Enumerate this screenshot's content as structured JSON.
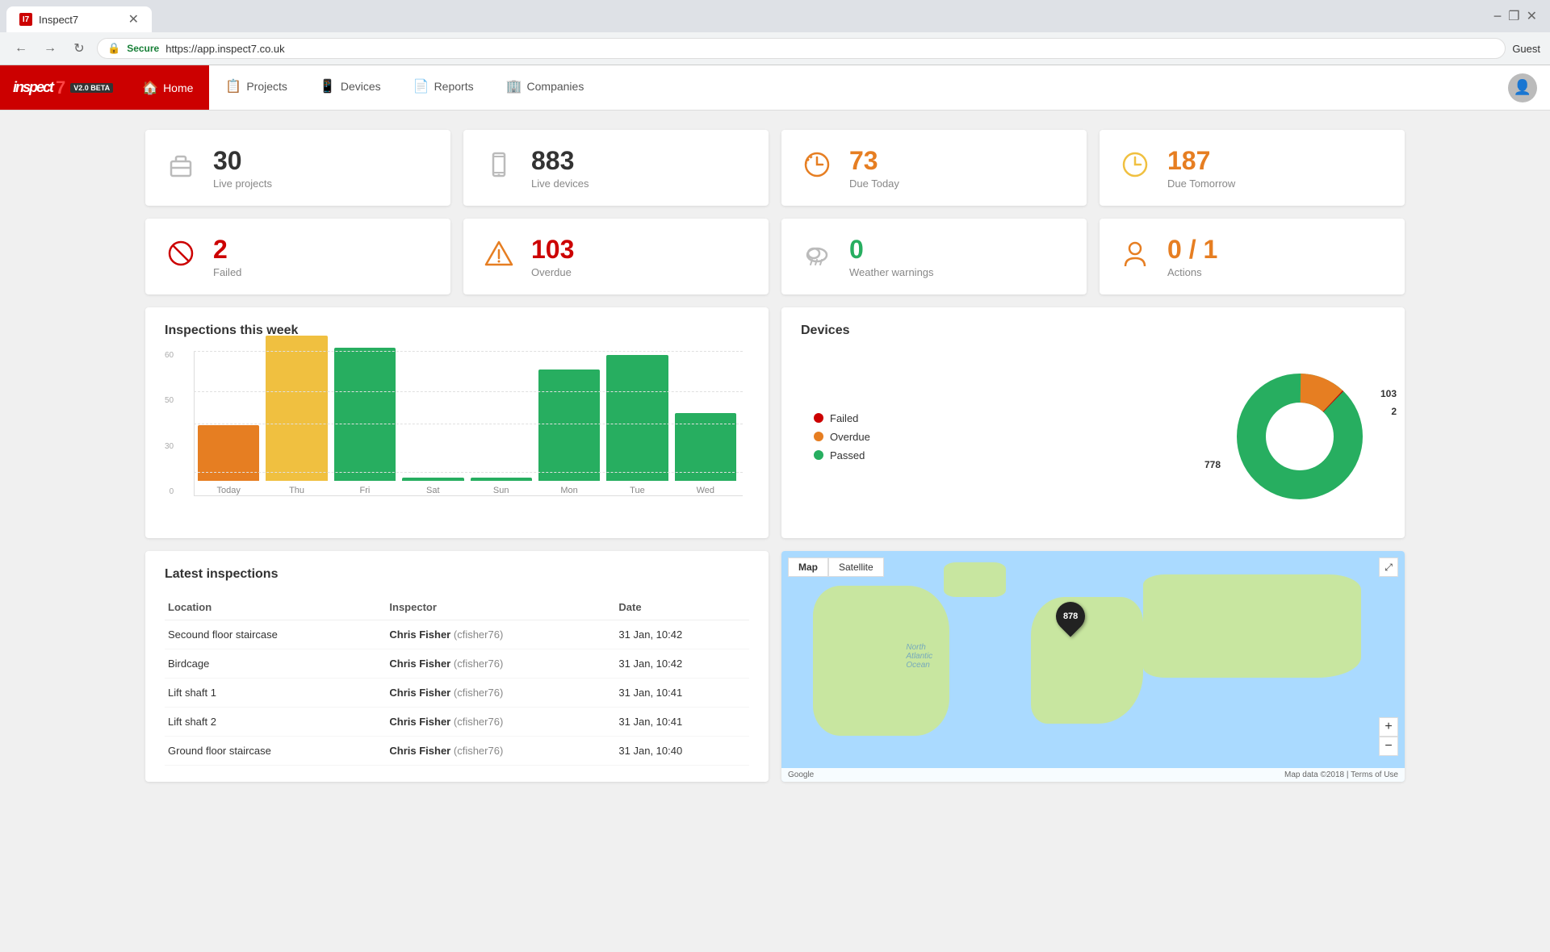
{
  "browser": {
    "tab_title": "Inspect7",
    "tab_favicon": "I7",
    "new_tab_label": "+",
    "user_label": "Guest",
    "minimize": "−",
    "maximize": "❐",
    "close": "✕",
    "secure_label": "Secure",
    "url": "https://app.inspect7.co.uk"
  },
  "nav": {
    "logo": "inspect",
    "logo_num": "7",
    "logo_version": "V2.0 BETA",
    "items": [
      {
        "id": "home",
        "label": "Home",
        "icon": "🏠",
        "active": true
      },
      {
        "id": "projects",
        "label": "Projects",
        "icon": "📋",
        "active": false
      },
      {
        "id": "devices",
        "label": "Devices",
        "icon": "📱",
        "active": false
      },
      {
        "id": "reports",
        "label": "Reports",
        "icon": "📄",
        "active": false
      },
      {
        "id": "companies",
        "label": "Companies",
        "icon": "🏢",
        "active": false
      }
    ]
  },
  "stats": [
    {
      "id": "live-projects",
      "number": "30",
      "label": "Live projects",
      "icon": "briefcase",
      "icon_color": "gray"
    },
    {
      "id": "live-devices",
      "number": "883",
      "label": "Live devices",
      "icon": "device",
      "icon_color": "gray"
    },
    {
      "id": "due-today",
      "number": "73",
      "label": "Due Today",
      "icon": "clock-orange",
      "icon_color": "orange"
    },
    {
      "id": "due-tomorrow",
      "number": "187",
      "label": "Due Tomorrow",
      "icon": "clock-yellow",
      "icon_color": "yellow"
    },
    {
      "id": "failed",
      "number": "2",
      "label": "Failed",
      "icon": "block-red",
      "icon_color": "red"
    },
    {
      "id": "overdue",
      "number": "103",
      "label": "Overdue",
      "icon": "warning-amber",
      "icon_color": "amber"
    },
    {
      "id": "weather",
      "number": "0",
      "label": "Weather warnings",
      "icon": "cloud-gray",
      "icon_color": "gray"
    },
    {
      "id": "actions",
      "number": "0 / 1",
      "label": "Actions",
      "icon": "person-orange",
      "icon_color": "orange"
    }
  ],
  "inspections_chart": {
    "title": "Inspections this week",
    "bars": [
      {
        "label": "Today",
        "value": 23,
        "color": "#e67e22"
      },
      {
        "label": "Thu",
        "value": 60,
        "color": "#f0c040"
      },
      {
        "label": "Fri",
        "value": 55,
        "color": "#27ae60"
      },
      {
        "label": "Sat",
        "value": 0,
        "color": "#27ae60"
      },
      {
        "label": "Sun",
        "value": 0,
        "color": "#27ae60"
      },
      {
        "label": "Mon",
        "value": 46,
        "color": "#27ae60"
      },
      {
        "label": "Tue",
        "value": 52,
        "color": "#27ae60"
      },
      {
        "label": "Wed",
        "value": 28,
        "color": "#27ae60"
      }
    ],
    "max": 60,
    "y_labels": [
      "60",
      "50",
      "30",
      "0"
    ]
  },
  "devices_chart": {
    "title": "Devices",
    "legend": [
      {
        "label": "Failed",
        "color": "#cc0000"
      },
      {
        "label": "Overdue",
        "color": "#e67e22"
      },
      {
        "label": "Passed",
        "color": "#27ae60"
      }
    ],
    "segments": [
      {
        "label": "Failed",
        "value": 2,
        "color": "#cc0000",
        "percent": 0.23
      },
      {
        "label": "Overdue",
        "value": 103,
        "color": "#e67e22",
        "percent": 11.74
      },
      {
        "label": "Passed",
        "value": 778,
        "color": "#27ae60",
        "percent": 88.03
      }
    ],
    "total": 883
  },
  "latest_inspections": {
    "title": "Latest inspections",
    "columns": [
      "Location",
      "Inspector",
      "Date"
    ],
    "rows": [
      {
        "location": "Secound floor staircase",
        "inspector_name": "Chris Fisher",
        "inspector_user": "cfisher76",
        "date": "31 Jan, 10:42"
      },
      {
        "location": "Birdcage",
        "inspector_name": "Chris Fisher",
        "inspector_user": "cfisher76",
        "date": "31 Jan, 10:42"
      },
      {
        "location": "Lift shaft 1",
        "inspector_name": "Chris Fisher",
        "inspector_user": "cfisher76",
        "date": "31 Jan, 10:41"
      },
      {
        "location": "Lift shaft 2",
        "inspector_name": "Chris Fisher",
        "inspector_user": "cfisher76",
        "date": "31 Jan, 10:41"
      },
      {
        "location": "Ground floor staircase",
        "inspector_name": "Chris Fisher",
        "inspector_user": "cfisher76",
        "date": "31 Jan, 10:40"
      }
    ]
  },
  "map": {
    "tabs": [
      "Map",
      "Satellite"
    ],
    "active_tab": "Map",
    "marker_count": "878",
    "footer_left": "Google",
    "footer_right": "Map data ©2018 | Terms of Use"
  }
}
